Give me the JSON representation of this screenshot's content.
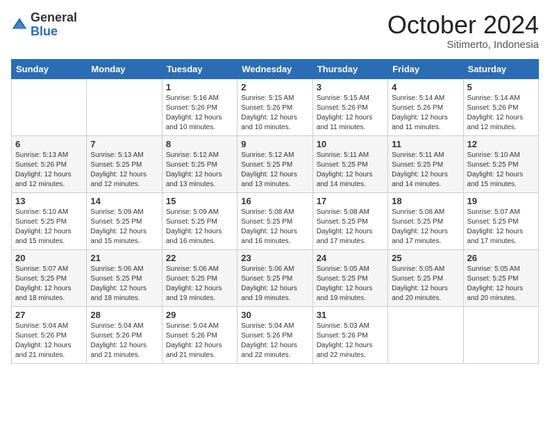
{
  "header": {
    "logo": {
      "general": "General",
      "blue": "Blue"
    },
    "title": "October 2024",
    "subtitle": "Sitimerto, Indonesia"
  },
  "days_header": [
    "Sunday",
    "Monday",
    "Tuesday",
    "Wednesday",
    "Thursday",
    "Friday",
    "Saturday"
  ],
  "weeks": [
    [
      null,
      null,
      {
        "day": "1",
        "sunrise": "5:16 AM",
        "sunset": "5:26 PM",
        "daylight": "12 hours and 10 minutes."
      },
      {
        "day": "2",
        "sunrise": "5:15 AM",
        "sunset": "5:26 PM",
        "daylight": "12 hours and 10 minutes."
      },
      {
        "day": "3",
        "sunrise": "5:15 AM",
        "sunset": "5:26 PM",
        "daylight": "12 hours and 11 minutes."
      },
      {
        "day": "4",
        "sunrise": "5:14 AM",
        "sunset": "5:26 PM",
        "daylight": "12 hours and 11 minutes."
      },
      {
        "day": "5",
        "sunrise": "5:14 AM",
        "sunset": "5:26 PM",
        "daylight": "12 hours and 12 minutes."
      }
    ],
    [
      {
        "day": "6",
        "sunrise": "5:13 AM",
        "sunset": "5:26 PM",
        "daylight": "12 hours and 12 minutes."
      },
      {
        "day": "7",
        "sunrise": "5:13 AM",
        "sunset": "5:25 PM",
        "daylight": "12 hours and 12 minutes."
      },
      {
        "day": "8",
        "sunrise": "5:12 AM",
        "sunset": "5:25 PM",
        "daylight": "12 hours and 13 minutes."
      },
      {
        "day": "9",
        "sunrise": "5:12 AM",
        "sunset": "5:25 PM",
        "daylight": "12 hours and 13 minutes."
      },
      {
        "day": "10",
        "sunrise": "5:11 AM",
        "sunset": "5:25 PM",
        "daylight": "12 hours and 14 minutes."
      },
      {
        "day": "11",
        "sunrise": "5:11 AM",
        "sunset": "5:25 PM",
        "daylight": "12 hours and 14 minutes."
      },
      {
        "day": "12",
        "sunrise": "5:10 AM",
        "sunset": "5:25 PM",
        "daylight": "12 hours and 15 minutes."
      }
    ],
    [
      {
        "day": "13",
        "sunrise": "5:10 AM",
        "sunset": "5:25 PM",
        "daylight": "12 hours and 15 minutes."
      },
      {
        "day": "14",
        "sunrise": "5:09 AM",
        "sunset": "5:25 PM",
        "daylight": "12 hours and 15 minutes."
      },
      {
        "day": "15",
        "sunrise": "5:09 AM",
        "sunset": "5:25 PM",
        "daylight": "12 hours and 16 minutes."
      },
      {
        "day": "16",
        "sunrise": "5:08 AM",
        "sunset": "5:25 PM",
        "daylight": "12 hours and 16 minutes."
      },
      {
        "day": "17",
        "sunrise": "5:08 AM",
        "sunset": "5:25 PM",
        "daylight": "12 hours and 17 minutes."
      },
      {
        "day": "18",
        "sunrise": "5:08 AM",
        "sunset": "5:25 PM",
        "daylight": "12 hours and 17 minutes."
      },
      {
        "day": "19",
        "sunrise": "5:07 AM",
        "sunset": "5:25 PM",
        "daylight": "12 hours and 17 minutes."
      }
    ],
    [
      {
        "day": "20",
        "sunrise": "5:07 AM",
        "sunset": "5:25 PM",
        "daylight": "12 hours and 18 minutes."
      },
      {
        "day": "21",
        "sunrise": "5:06 AM",
        "sunset": "5:25 PM",
        "daylight": "12 hours and 18 minutes."
      },
      {
        "day": "22",
        "sunrise": "5:06 AM",
        "sunset": "5:25 PM",
        "daylight": "12 hours and 19 minutes."
      },
      {
        "day": "23",
        "sunrise": "5:06 AM",
        "sunset": "5:25 PM",
        "daylight": "12 hours and 19 minutes."
      },
      {
        "day": "24",
        "sunrise": "5:05 AM",
        "sunset": "5:25 PM",
        "daylight": "12 hours and 19 minutes."
      },
      {
        "day": "25",
        "sunrise": "5:05 AM",
        "sunset": "5:25 PM",
        "daylight": "12 hours and 20 minutes."
      },
      {
        "day": "26",
        "sunrise": "5:05 AM",
        "sunset": "5:25 PM",
        "daylight": "12 hours and 20 minutes."
      }
    ],
    [
      {
        "day": "27",
        "sunrise": "5:04 AM",
        "sunset": "5:26 PM",
        "daylight": "12 hours and 21 minutes."
      },
      {
        "day": "28",
        "sunrise": "5:04 AM",
        "sunset": "5:26 PM",
        "daylight": "12 hours and 21 minutes."
      },
      {
        "day": "29",
        "sunrise": "5:04 AM",
        "sunset": "5:26 PM",
        "daylight": "12 hours and 21 minutes."
      },
      {
        "day": "30",
        "sunrise": "5:04 AM",
        "sunset": "5:26 PM",
        "daylight": "12 hours and 22 minutes."
      },
      {
        "day": "31",
        "sunrise": "5:03 AM",
        "sunset": "5:26 PM",
        "daylight": "12 hours and 22 minutes."
      },
      null,
      null
    ]
  ],
  "labels": {
    "sunrise": "Sunrise:",
    "sunset": "Sunset:",
    "daylight": "Daylight:"
  }
}
